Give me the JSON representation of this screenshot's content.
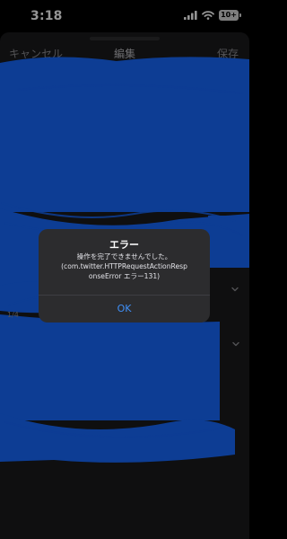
{
  "status_bar": {
    "time": "3:18",
    "signal_icon": "cellular-signal-icon",
    "wifi_icon": "wifi-icon",
    "battery_label": "10+"
  },
  "nav": {
    "cancel_label": "キャンセル",
    "title": "編集",
    "save_label": "保存"
  },
  "form": {
    "row_label": "1/4",
    "chevron_icon": "chevron-down-icon"
  },
  "alert": {
    "title": "エラー",
    "message_lines": [
      "操作を完了できませんでした。",
      "(com.twitter.HTTPRequestActionResp",
      "onseError エラー131)"
    ],
    "ok_label": "OK"
  },
  "colors": {
    "redaction_blue": "#1769ff",
    "accent_blue": "#3f8ff7",
    "sheet_background": "#1a1a1c",
    "alert_background": "#2c2c2e"
  }
}
